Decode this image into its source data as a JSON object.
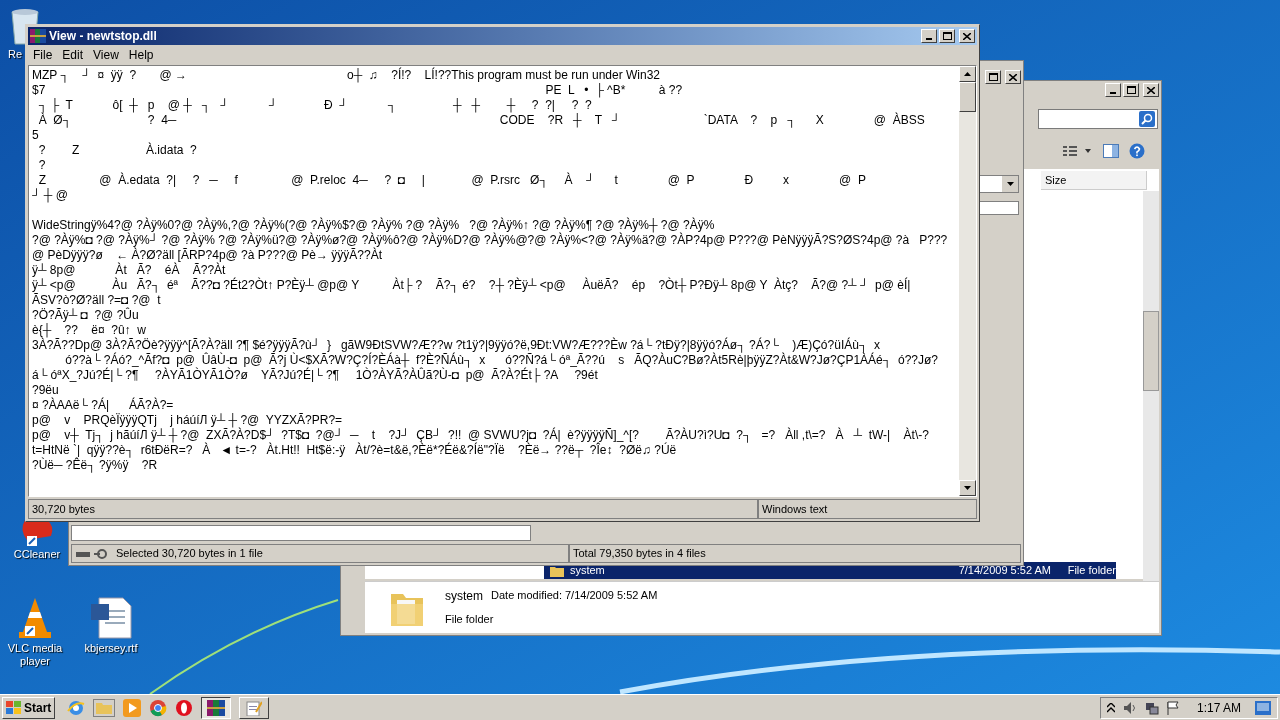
{
  "desktop_icons": [
    {
      "kind": "recycle",
      "label": "Re"
    },
    {
      "kind": "ccleaner",
      "label": "CCleaner"
    },
    {
      "kind": "vlc",
      "label": "VLC media player"
    },
    {
      "kind": "word",
      "label": "kbjersey.rtf"
    }
  ],
  "explorer_window": {
    "column_header": "Size",
    "selected_row": {
      "name": "system",
      "date": "7/14/2009 5:52 AM",
      "type": "File folder"
    },
    "details": {
      "name": "system",
      "date_modified": "Date modified: 7/14/2009 5:52 AM",
      "type": "File folder"
    }
  },
  "file_manager": {
    "status_left": "Selected 30,720 bytes in 1 file",
    "status_right": "Total 79,350 bytes in 4 files"
  },
  "viewer": {
    "title": "View - newtstop.dll",
    "menu": [
      "File",
      "Edit",
      "View",
      "Help"
    ],
    "text_blocks": [
      {
        "lines": [
          {
            "text": "MZP ┐    ┘  ¤  ÿÿ  ?       @ →                                                o┼  ♫    ?Í!?    LÍ!??This program must be run under Win32"
          },
          {
            "text": "$7                                                                                                                                                      PE  L   •  ├ ^B*          à ??"
          },
          {
            "text": "  ┐ ├  T            ô[  ┼   p    @ ┼   ┐   ┘            ┘              Ð  ┘            ┐                 ┼   ┼        ┼     ?  ?|     ?  ?"
          },
          {
            "text": "  À  Ø┐                       ?  4─                                                                                                 CODE    ?R   ┼    T   ┘                         `DATA    ?    p   ┐      X               @  ÀBSS"
          },
          {
            "text": "5"
          },
          {
            "text": "  ?        Z                    À.idata  ?"
          },
          {
            "text": "  ?"
          },
          {
            "text": "  Z                @  À.edata  ?|     ?   ─     f                @  P.reloc  4─     ?  ◘     |              @  P.rsrc   Ø┐     À    ┘      t               @  P               Ð         x               @  P"
          },
          {
            "text": "┘ ┼ @"
          }
        ]
      },
      {
        "lines": [
          {
            "text": "WideStringÿ%4?@ ?Àÿ%0?@ ?Àÿ%,?@ ?Àÿ%(?@ ?Àÿ%$?@ ?Àÿ% ?@ ?Àÿ%   ?@ ?Àÿ%↑ ?@ ?Àÿ%¶ ?@ ?Àÿ%┼ ?@ ?Àÿ%"
          },
          {
            "text": "?@ ?Àÿ%◘ ?@ ?Àÿ%┘ ?@ ?Àÿ% ?@ ?Àÿ%ü?@ ?Àÿ%ø?@ ?Àÿ%ô?@ ?Àÿ%D?@ ?Àÿ%@?@ ?Àÿ%<?@ ?Àÿ%ä?@ ?ÀP?4p@ P???@ PèNÿÿÿÃ?S?ØS?4p@ ?à   P???"
          },
          {
            "text": "@ PèDÿÿÿ?ø    ← À?Ø?äll [ÃRP?4p@ ?à P???@ Pè→ ÿÿÿÃ??Àt"
          },
          {
            "text": "ÿ┴ 8p@            Àt   Ã?    éÀ    Ã??Àt"
          },
          {
            "text": "ÿ┴ <p@           Àu   Ã?┐  éª    Ã??◘ ?Ét2?Òt↑ P?Èÿ┴ @p@ Y          Àt├ ?    Ã?┐ é?    ?┼ ?Èÿ┴ <p@     ÀuëÃ?    ép    ?Òt┼ P?Ðÿ┴ 8p@ Y  Àtç?    Ã?@ ?┴ ┘  p@ èÍ|"
          },
          {
            "text": "ÃSV?ò?Ø?äll ?=◘ ?@  t"
          },
          {
            "text": "?Ö?Ãÿ┴ ◘  ?@ ?Ûu"
          },
          {
            "text": "è{┼    ??    ë¤  ?û↑  w"
          },
          {
            "text": "3À?Ã??Dp@ 3À?Ã?Öè?ÿÿÿ^[Ã?À?äll ?¶ $é?ÿÿÿÃ?ù┘  }   gãW9ÐtSVW?Æ??w ?t1ÿ?|9ÿÿó?ë,9Ðt:VW?Æ???Èw ?á└ ?tÐÿ?|8ÿÿó?Áø┐ ?Á?└    )Æ)Çó?üIÁù┐  x"
          },
          {
            "text": "          ó??à└ ?Áó?_^Ãf?◘  p@  ÛâÙ-◘  p@  Ã?j Ù<$XÃ?W?Ç?Í?ÈÁà┼  f?È?ÑÁù┐  x      ó??Ñ?á└ óª_Ã??ú    s   ÃQ?ÀuC?Bø?Àt5Rè|þÿÿZ?Àt&W?Jø?ÇP1ÀÁé┐  ó??Jø?"
          },
          {
            "text": "á└ óªX_?Jú?É|└ ?¶     ?ÀYÃ1ÒYÃ1Ò?ø    YÃ?Jú?É|└ ?¶     1Ò?ÀYÃ?ÀÛã?Ù-◘  p@  Ã?À?Ét├ ?A     ?9ét"
          },
          {
            "text": "?9ëu"
          },
          {
            "text": "¤ ?ÀAAë└ ?Á|      ÁÃ?À?="
          },
          {
            "text": "p@    v    PRQèÏÿÿÿQTj    j háúíЛ ÿ┴ ┼ ?@  YYZXÃ?PR?="
          },
          {
            "text": "p@    v┼  Tj┐  j hãúíЛ ÿ┴ ┼ ?@  ZXÃ?À?D$┘  ?T$◘  ?@┘  ─    t    ?J┘  ÇB┘  ?!!  @ SVWU?j◘  ?Á|  è?ÿÿÿÿÑ]_^[?        Ã?ÀU?ì?U◘  ?┐   =?   Àll ,t\\=?   À   ┴  tW-|    Àt\\-?"
          },
          {
            "text": "t=HtNë `|  qÿÿ??è┐  r6tÐëR=?   À   ◄ t=-?   Àt.Ht!!  Ht$ë:-ÿ   Àt/?è=t&ë,?Èë*?Éë&?Íë\"?Ïë    ?Èë→ ??ë┬  ?Îe↕  ?Øë♫ ?Úë"
          },
          {
            "text": "?Ùë─ ?Êë┐ ?ÿ%ÿ    ?R"
          }
        ]
      }
    ],
    "status": {
      "size": "30,720 bytes",
      "encoding": "Windows text"
    }
  },
  "taskbar": {
    "start": "Start",
    "clock": "1:17 AM"
  }
}
